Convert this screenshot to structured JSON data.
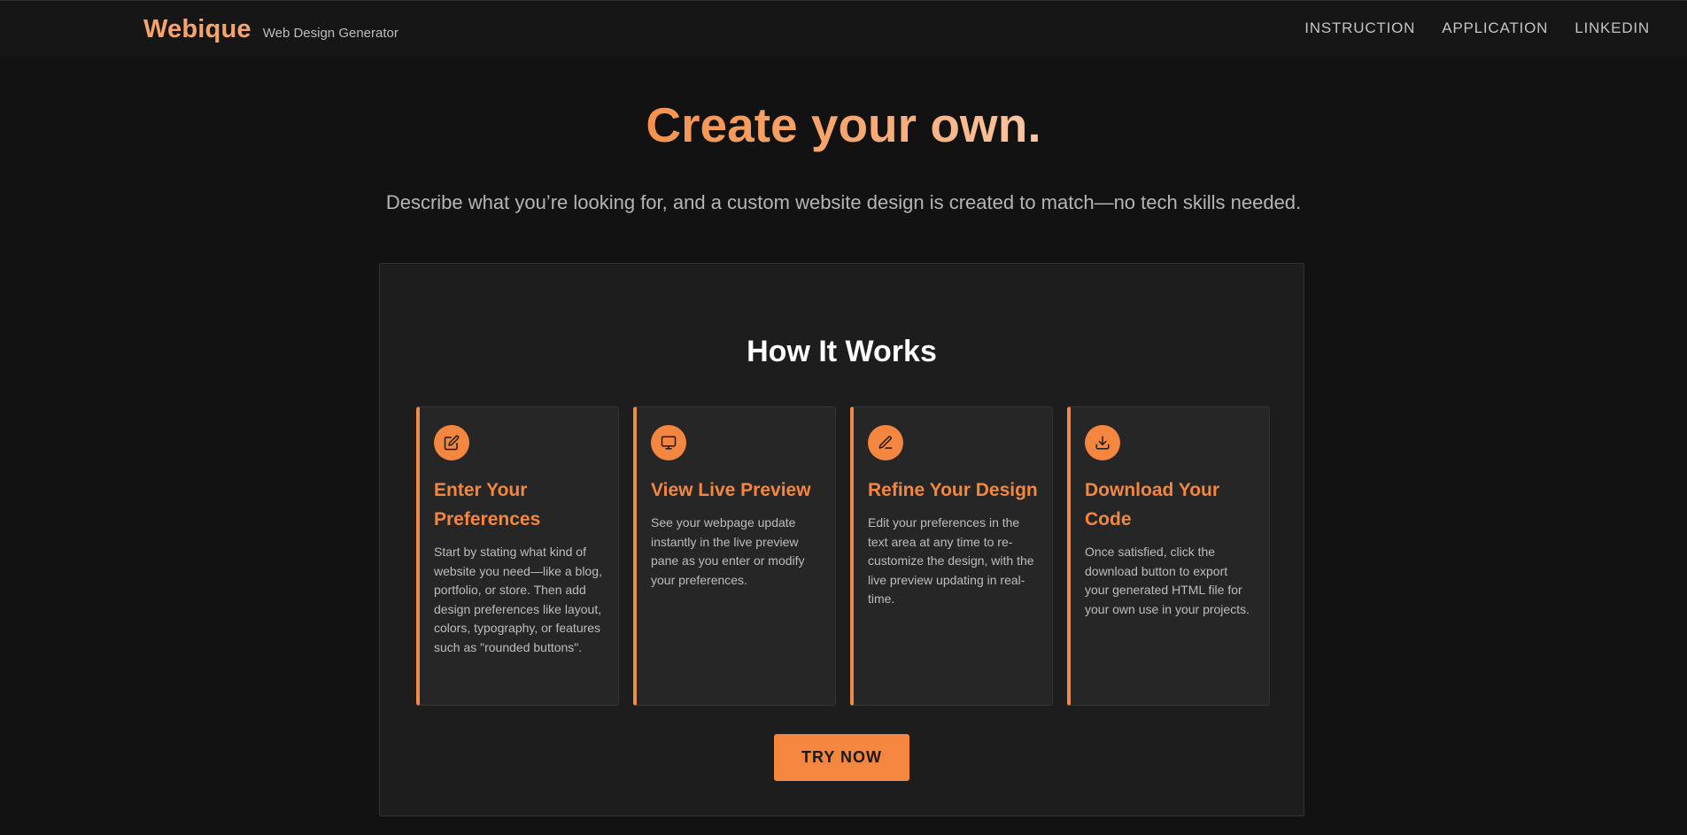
{
  "header": {
    "brand_name": "Webique",
    "brand_tagline": "Web Design Generator",
    "nav": [
      "INSTRUCTION",
      "APPLICATION",
      "LINKEDIN"
    ]
  },
  "hero": {
    "title": "Create your own.",
    "subtitle": "Describe what you’re looking for, and a custom website design is created to match—no tech skills needed."
  },
  "how_it_works": {
    "title": "How It Works",
    "cards": [
      {
        "icon": "edit-icon",
        "title": "Enter Your Preferences",
        "text": "Start by stating what kind of website you need—like a blog, portfolio, or store. Then add design preferences like layout, colors, typography, or features such as \"rounded buttons\"."
      },
      {
        "icon": "monitor-icon",
        "title": "View Live Preview",
        "text": "See your webpage update instantly in the live preview pane as you enter or modify your preferences."
      },
      {
        "icon": "pen-icon",
        "title": "Refine Your Design",
        "text": "Edit your preferences in the text area at any time to re-customize the design, with the live preview updating in real-time."
      },
      {
        "icon": "download-icon",
        "title": "Download Your Code",
        "text": "Once satisfied, click the download button to export your generated HTML file for your own use in your projects."
      }
    ],
    "cta_label": "TRY NOW"
  },
  "colors": {
    "accent": "#f5863f",
    "background": "#121212",
    "panel": "#1d1d1d",
    "card": "#262626"
  }
}
